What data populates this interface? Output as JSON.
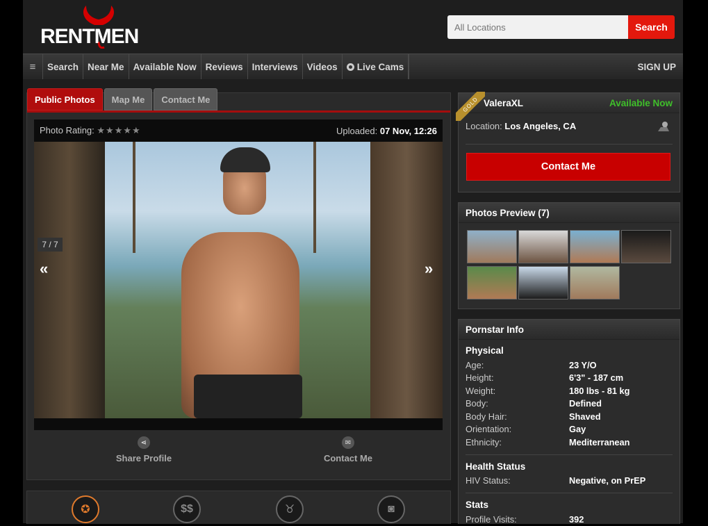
{
  "brand": {
    "logo_text": "RENTMEN"
  },
  "search": {
    "placeholder": "All Locations",
    "button": "Search"
  },
  "nav": {
    "items": [
      "Search",
      "Near Me",
      "Available Now",
      "Reviews",
      "Interviews",
      "Videos",
      "Live Cams"
    ],
    "signup": "SIGN UP"
  },
  "tabs": [
    "Public Photos",
    "Map Me",
    "Contact Me"
  ],
  "viewer": {
    "rating_label": "Photo Rating:",
    "stars": "★★★★★",
    "uploaded_label": "Uploaded:",
    "uploaded_value": "07 Nov, 12:26",
    "counter": "7 / 7",
    "prev": "«",
    "next": "»"
  },
  "actions": {
    "share": "Share Profile",
    "contact": "Contact Me"
  },
  "profile": {
    "badge": "GOLD",
    "name": "ValeraXL",
    "status": "Available Now",
    "location_label": "Location:",
    "location_value": "Los Angeles, CA",
    "contact_button": "Contact Me"
  },
  "photos_preview": {
    "title": "Photos Preview (7)"
  },
  "pornstar_info": {
    "title": "Pornstar Info",
    "physical_title": "Physical",
    "physical": [
      {
        "k": "Age:",
        "v": "23 Y/O"
      },
      {
        "k": "Height:",
        "v": "6'3\" - 187 cm"
      },
      {
        "k": "Weight:",
        "v": "180 lbs - 81 kg"
      },
      {
        "k": "Body:",
        "v": "Defined"
      },
      {
        "k": "Body Hair:",
        "v": "Shaved"
      },
      {
        "k": "Orientation:",
        "v": "Gay"
      },
      {
        "k": "Ethnicity:",
        "v": "Mediterranean"
      }
    ],
    "health_title": "Health Status",
    "health": [
      {
        "k": "HIV Status:",
        "v": "Negative, on PrEP"
      }
    ],
    "stats_title": "Stats",
    "stats": [
      {
        "k": "Profile Visits:",
        "v": "392"
      }
    ]
  },
  "colors": {
    "accent": "#e3180d",
    "available": "#3fbf2a",
    "gold": "#b8902d"
  }
}
